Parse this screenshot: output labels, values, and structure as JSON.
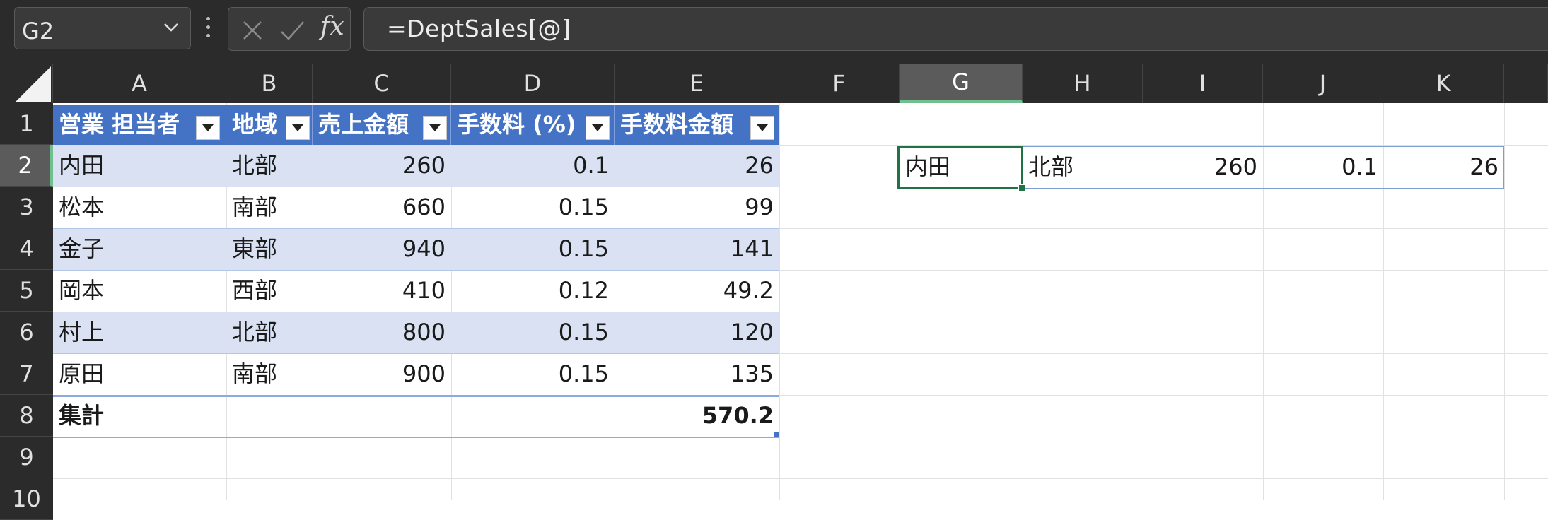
{
  "name_box": {
    "value": "G2"
  },
  "formula_bar": {
    "formula": "=DeptSales[@]",
    "cancel_icon": "close-icon",
    "enter_icon": "check-icon",
    "function_label": "fx"
  },
  "columns": [
    "A",
    "B",
    "C",
    "D",
    "E",
    "F",
    "G",
    "H",
    "I",
    "J",
    "K"
  ],
  "selected_column": "G",
  "rows": [
    "1",
    "2",
    "3",
    "4",
    "5",
    "6",
    "7",
    "8",
    "9",
    "10"
  ],
  "selected_row": "2",
  "table": {
    "headers": [
      "営業 担当者",
      "地域",
      "売上金額",
      "手数料 (%)",
      "手数料金額"
    ],
    "data": [
      [
        "内田",
        "北部",
        "260",
        "0.1",
        "26"
      ],
      [
        "松本",
        "南部",
        "660",
        "0.15",
        "99"
      ],
      [
        "金子",
        "東部",
        "940",
        "0.15",
        "141"
      ],
      [
        "岡本",
        "西部",
        "410",
        "0.12",
        "49.2"
      ],
      [
        "村上",
        "北部",
        "800",
        "0.15",
        "120"
      ],
      [
        "原田",
        "南部",
        "900",
        "0.15",
        "135"
      ]
    ],
    "total_label": "集計",
    "total_value": "570.2",
    "header_color": "#4472c4",
    "band_color": "#d9e1f2"
  },
  "spill": [
    "内田",
    "北部",
    "260",
    "0.1",
    "26"
  ],
  "colors": {
    "active_cell_border": "#217346",
    "header_bg": "#2b2b2b"
  }
}
